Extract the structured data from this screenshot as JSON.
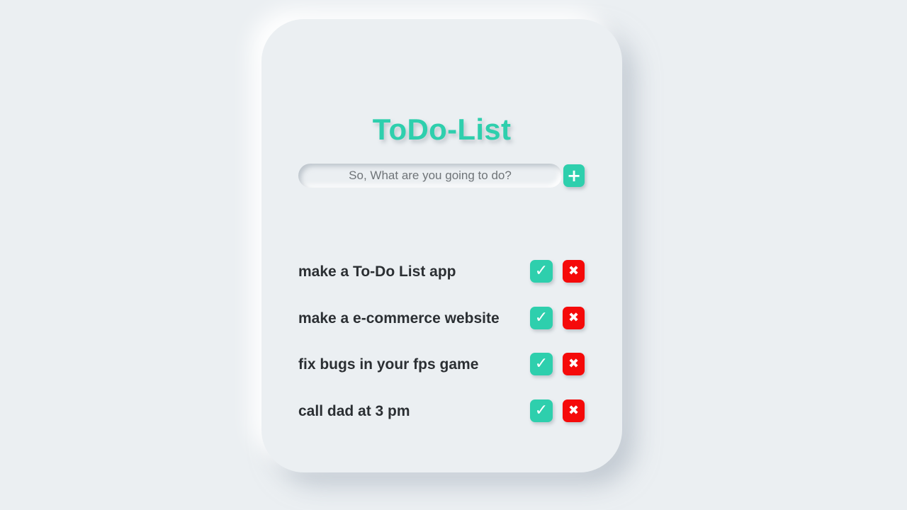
{
  "app": {
    "title": "ToDo-List"
  },
  "input": {
    "placeholder": "So, What are you going to do?",
    "value": ""
  },
  "icons": {
    "add": "+",
    "done": "✓",
    "delete": "✖"
  },
  "colors": {
    "accent": "#2ecfad",
    "danger": "#f50a0a",
    "background": "#ebeff2",
    "text": "#2b2f33"
  },
  "tasks": [
    {
      "label": "make a To-Do List app"
    },
    {
      "label": "make a e-commerce website"
    },
    {
      "label": "fix bugs in your fps game"
    },
    {
      "label": "call dad at 3 pm"
    }
  ]
}
